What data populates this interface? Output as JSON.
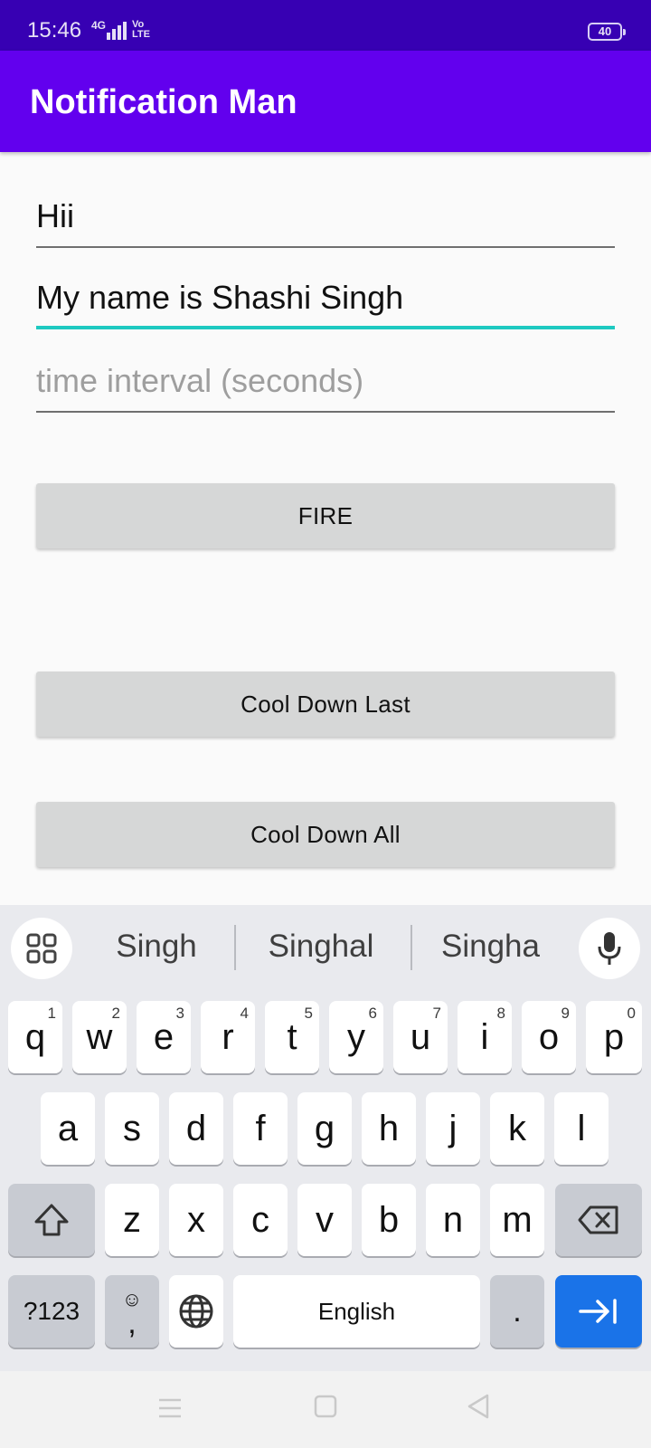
{
  "status_bar": {
    "time": "15:46",
    "network": "4G",
    "volte_top": "Vo",
    "volte_bottom": "LTE",
    "battery": "40"
  },
  "app_bar": {
    "title": "Notification Man"
  },
  "form": {
    "title_field": {
      "value": "Hii",
      "placeholder": ""
    },
    "message_field": {
      "value": "My name is Shashi Singh",
      "placeholder": ""
    },
    "interval_field": {
      "value": "",
      "placeholder": "time interval (seconds)"
    }
  },
  "buttons": {
    "fire": "FIRE",
    "cool_down_last": "Cool Down Last",
    "cool_down_all": "Cool Down All"
  },
  "keyboard": {
    "suggestions": [
      "Singh",
      "Singhal",
      "Singha"
    ],
    "row1": [
      {
        "key": "q",
        "hint": "1"
      },
      {
        "key": "w",
        "hint": "2"
      },
      {
        "key": "e",
        "hint": "3"
      },
      {
        "key": "r",
        "hint": "4"
      },
      {
        "key": "t",
        "hint": "5"
      },
      {
        "key": "y",
        "hint": "6"
      },
      {
        "key": "u",
        "hint": "7"
      },
      {
        "key": "i",
        "hint": "8"
      },
      {
        "key": "o",
        "hint": "9"
      },
      {
        "key": "p",
        "hint": "0"
      }
    ],
    "row2": [
      "a",
      "s",
      "d",
      "f",
      "g",
      "h",
      "j",
      "k",
      "l"
    ],
    "row3": [
      "z",
      "x",
      "c",
      "v",
      "b",
      "n",
      "m"
    ],
    "symbols_key": "?123",
    "emoji_glyph": "☺",
    "comma_key": ",",
    "space_label": "English",
    "period_key": ".",
    "icons": {
      "apps": "keyboard-apps-icon",
      "mic": "microphone-icon",
      "shift": "shift-icon",
      "backspace": "backspace-icon",
      "globe": "globe-icon",
      "enter": "next-field-icon"
    }
  },
  "nav_bar": {
    "icons": [
      "menu-icon",
      "home-square-icon",
      "back-triangle-icon"
    ]
  },
  "colors": {
    "status_bar": "#3700b3",
    "app_bar": "#6200ee",
    "focus_underline": "#1ec9c1",
    "button_bg": "#d6d7d7",
    "action_key": "#1a73e8"
  }
}
